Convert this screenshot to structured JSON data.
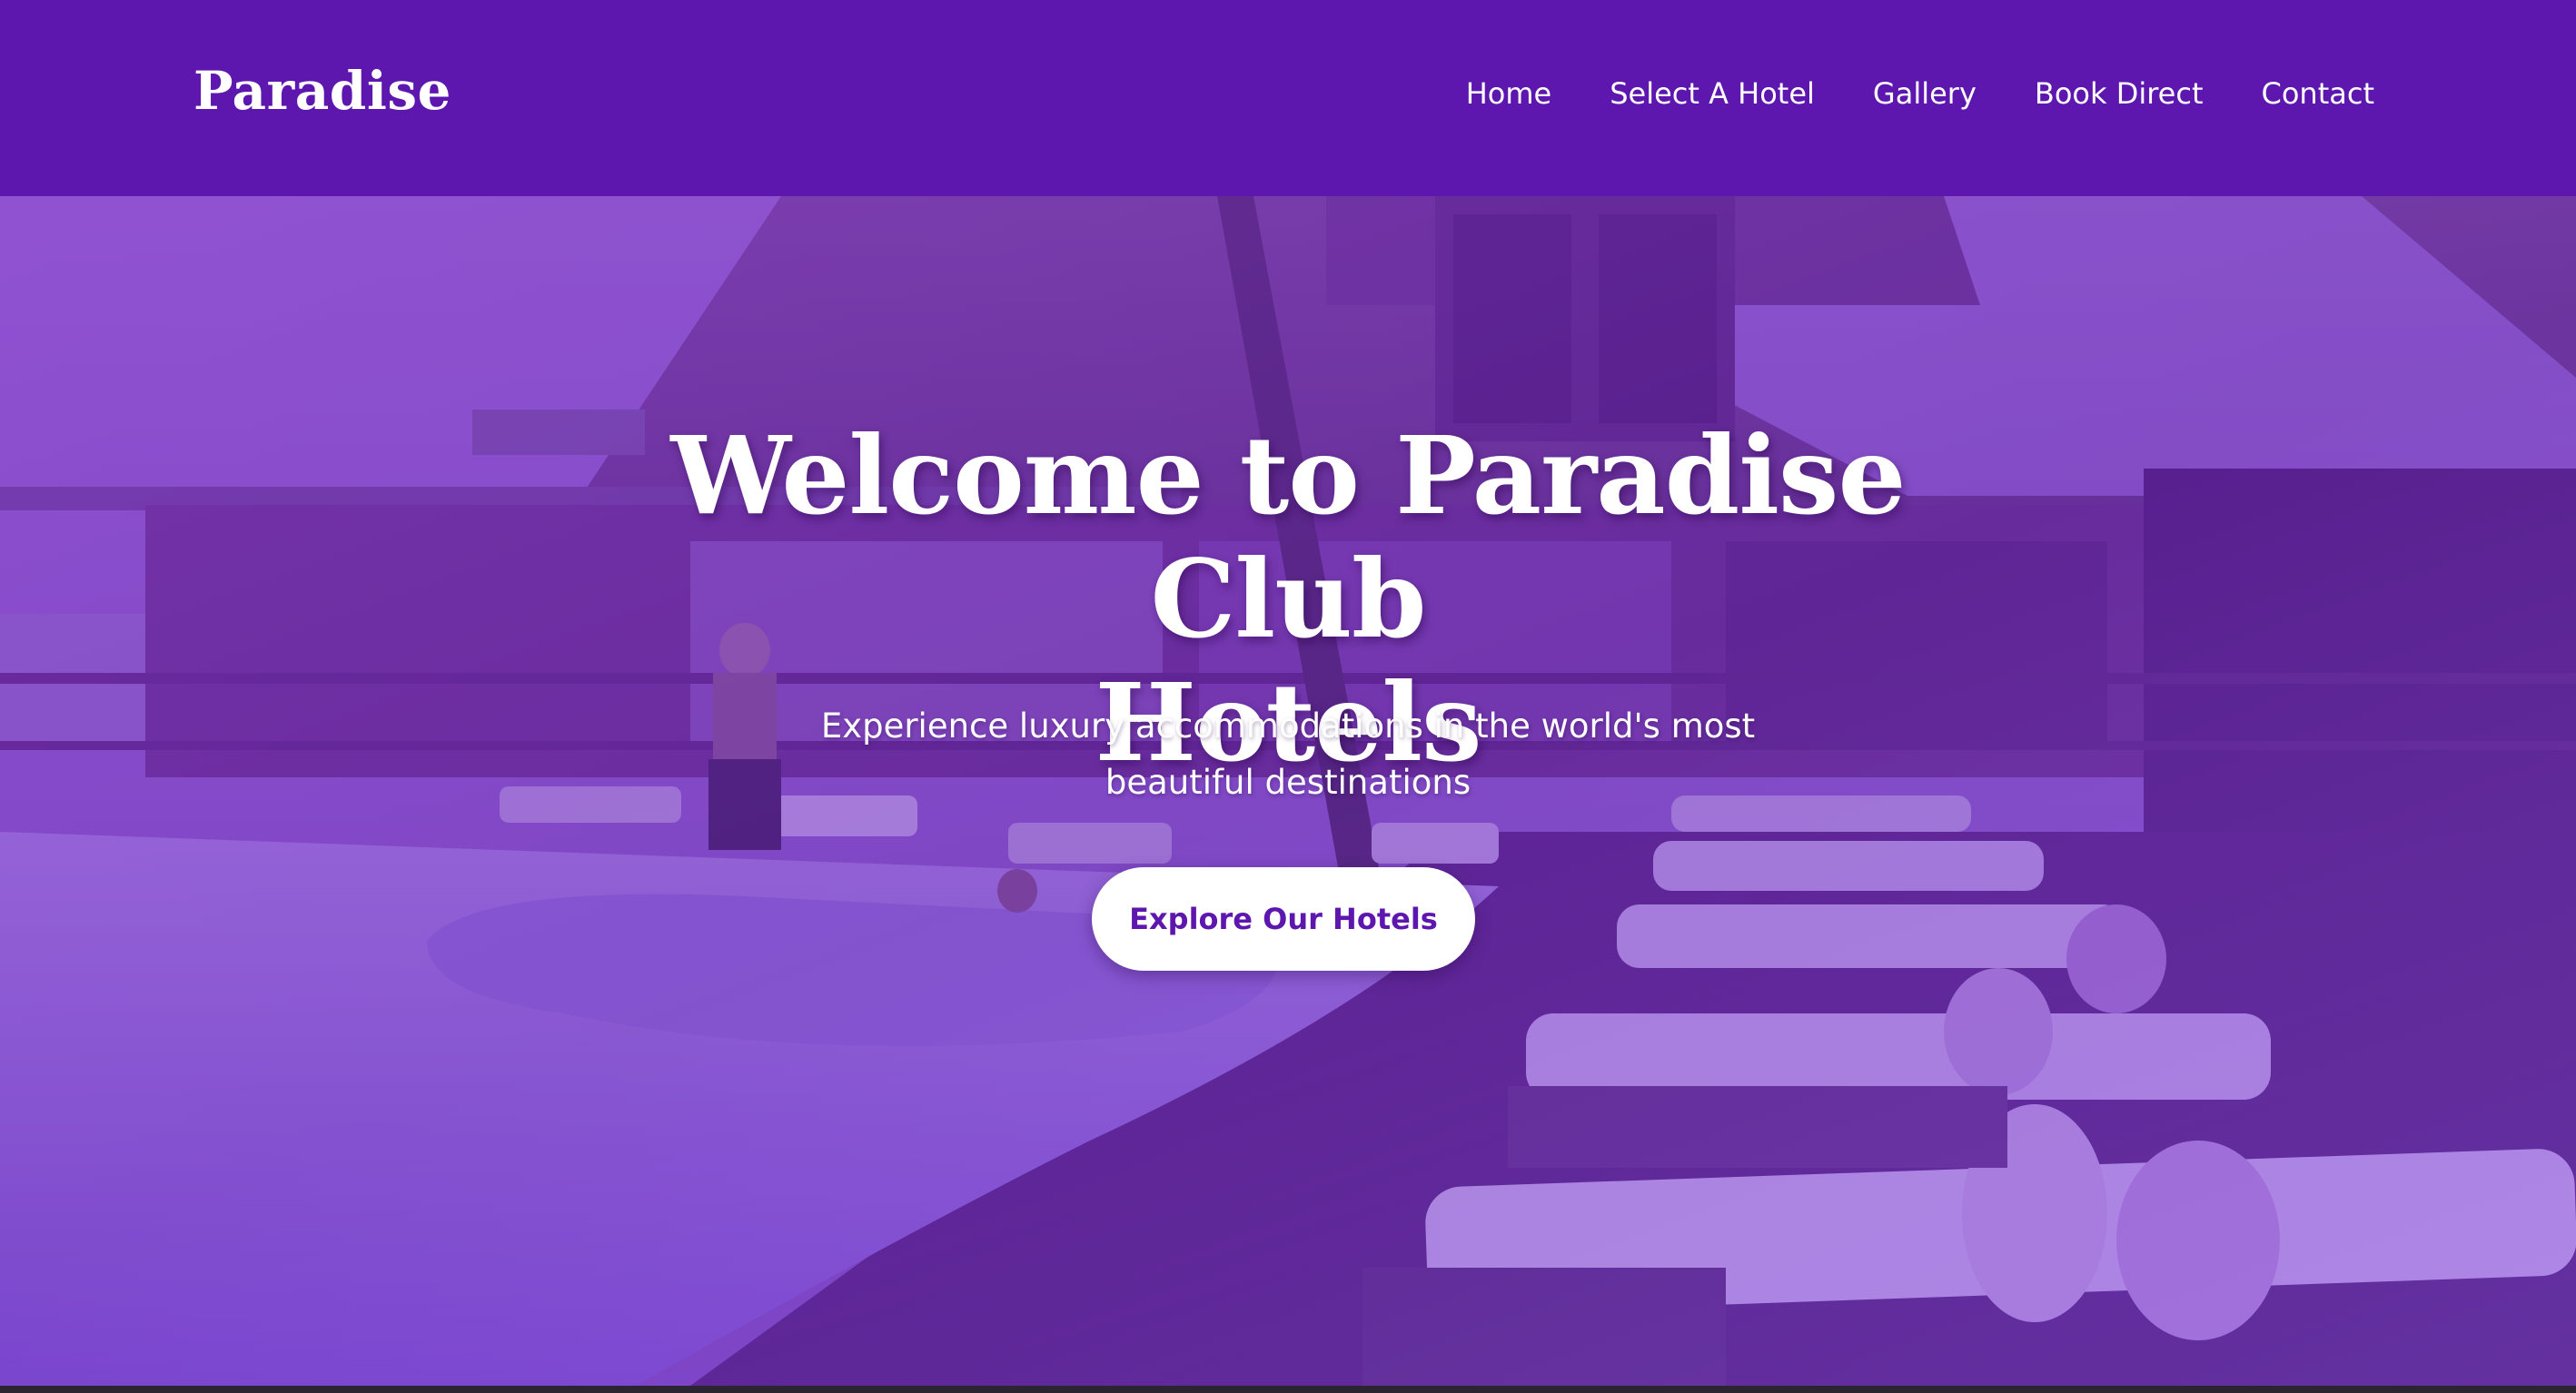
{
  "header": {
    "brand": "Paradise",
    "nav": [
      {
        "label": "Home"
      },
      {
        "label": "Select A Hotel"
      },
      {
        "label": "Gallery"
      },
      {
        "label": "Book Direct"
      },
      {
        "label": "Contact"
      }
    ]
  },
  "hero": {
    "title_line1": "Welcome to Paradise Club",
    "title_line2": "Hotels",
    "subtitle_line1": "Experience luxury accommodations in the world's most",
    "subtitle_line2": "beautiful destinations",
    "cta_label": "Explore Our Hotels"
  },
  "colors": {
    "brand_purple": "#5e17ae",
    "white": "#ffffff",
    "overlay_purple": "#8232d2"
  },
  "icons": []
}
